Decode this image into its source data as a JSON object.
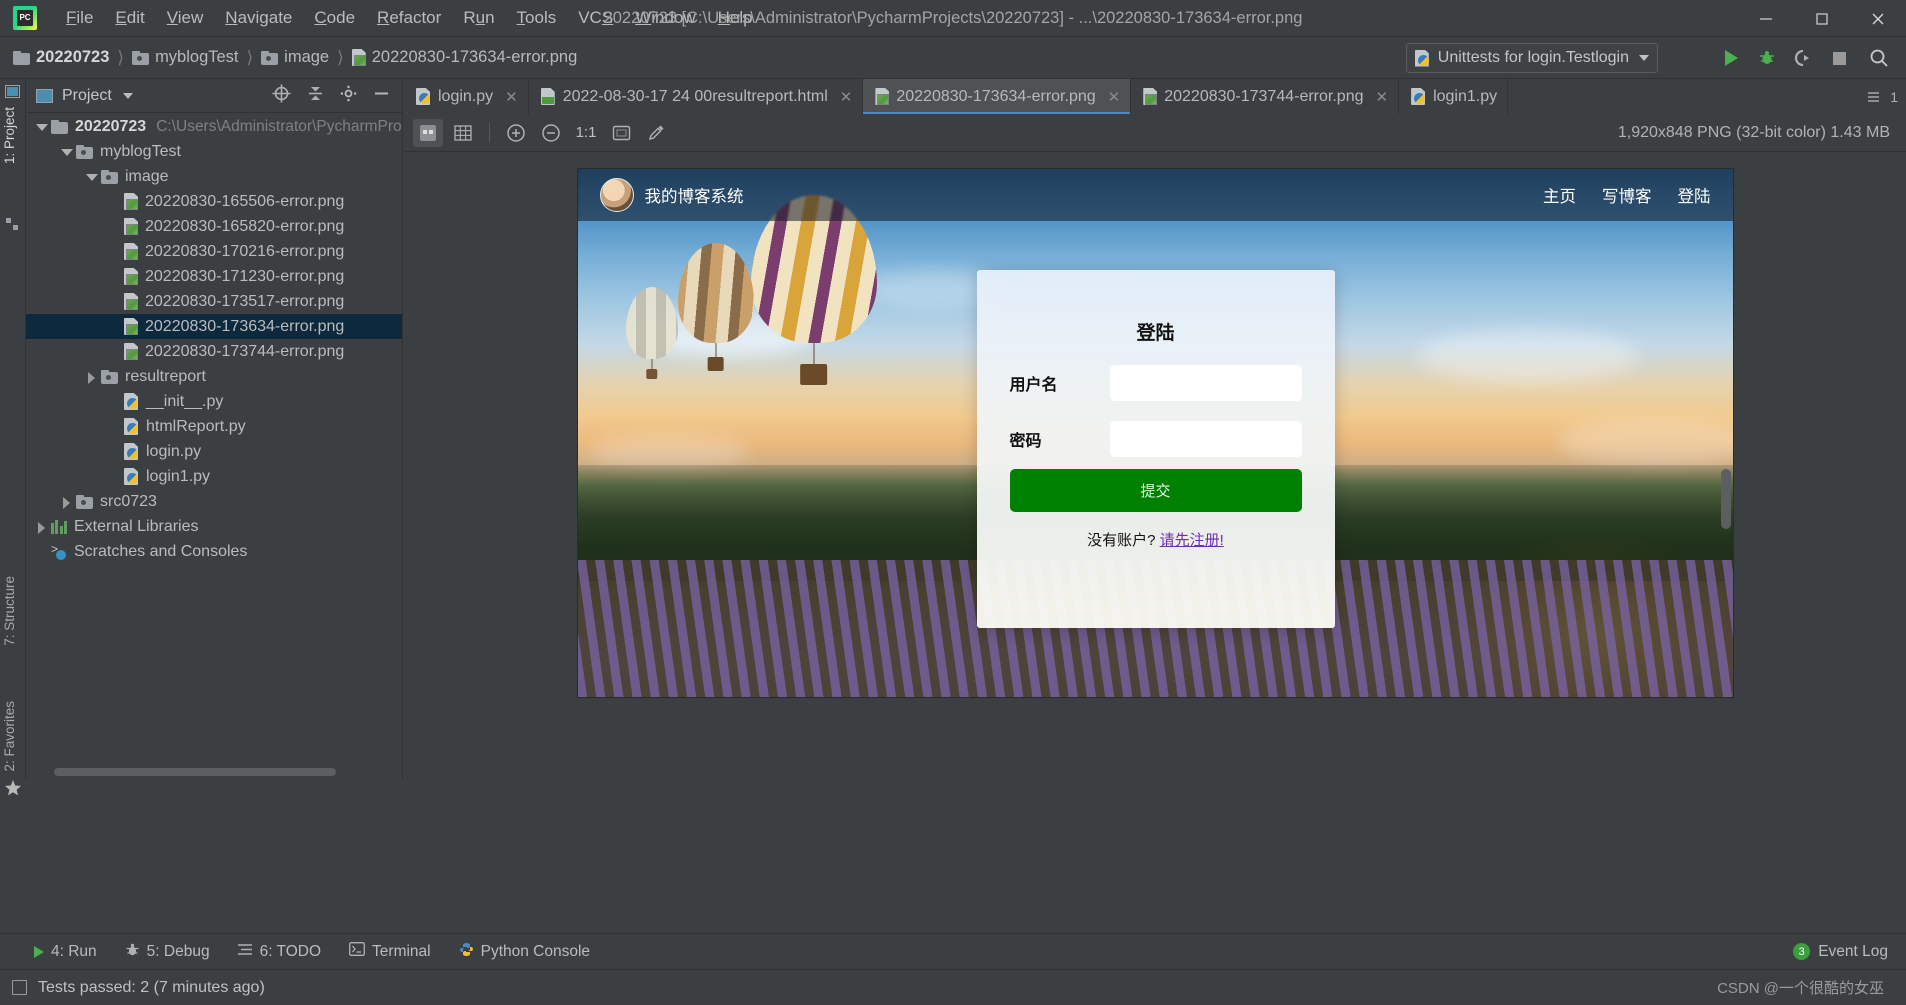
{
  "window": {
    "title": "20220723 [C:\\Users\\Administrator\\PycharmProjects\\20220723] - ...\\20220830-173634-error.png",
    "minimize_label": "—",
    "maximize_label": "☐",
    "close_label": "✕",
    "logo_label": "PC"
  },
  "menubar": [
    {
      "label": "File",
      "mnemonic": "F"
    },
    {
      "label": "Edit",
      "mnemonic": "E"
    },
    {
      "label": "View",
      "mnemonic": "V"
    },
    {
      "label": "Navigate",
      "mnemonic": "N"
    },
    {
      "label": "Code",
      "mnemonic": "C"
    },
    {
      "label": "Refactor",
      "mnemonic": "R"
    },
    {
      "label": "Run",
      "mnemonic": "u"
    },
    {
      "label": "Tools",
      "mnemonic": "T"
    },
    {
      "label": "VCS",
      "mnemonic": "S"
    },
    {
      "label": "Window",
      "mnemonic": "W"
    },
    {
      "label": "Help",
      "mnemonic": "H"
    }
  ],
  "breadcrumb": [
    {
      "label": "20220723",
      "icon": "folder-icon",
      "bold": true
    },
    {
      "label": "myblogTest",
      "icon": "folder-icon",
      "bold": false
    },
    {
      "label": "image",
      "icon": "folder-icon",
      "bold": false
    },
    {
      "label": "20220830-173634-error.png",
      "icon": "image-file-icon",
      "bold": false
    }
  ],
  "run_config": {
    "label": "Unittests for login.Testlogin",
    "icon": "python-test-icon",
    "dropdown_icon": "chevron-down-icon"
  },
  "nav_actions": [
    {
      "name": "run-button",
      "icon": "play-icon"
    },
    {
      "name": "debug-button",
      "icon": "bug-icon"
    },
    {
      "name": "run-with-coverage-button",
      "icon": "coverage-icon"
    },
    {
      "name": "stop-button",
      "icon": "stop-icon"
    },
    {
      "name": "search-everywhere-button",
      "icon": "search-icon"
    }
  ],
  "left_strip": [
    {
      "label": "1: Project",
      "selected": true
    },
    {
      "label": "7: Structure",
      "selected": false
    },
    {
      "label": "2: Favorites",
      "selected": false
    }
  ],
  "project_panel": {
    "title": "Project",
    "caret_icon": "chevron-down-icon",
    "header_actions": [
      {
        "name": "select-opened-file-button",
        "icon": "target-icon"
      },
      {
        "name": "collapse-all-button",
        "icon": "collapse-icon"
      },
      {
        "name": "settings-button",
        "icon": "gear-icon"
      },
      {
        "name": "hide-button",
        "icon": "minus-icon"
      }
    ],
    "tree": [
      {
        "label": "20220723",
        "path": "C:\\Users\\Administrator\\PycharmPro",
        "indent": 0,
        "arrow": "down",
        "icon": "folder-icon",
        "bold": true,
        "selected": false
      },
      {
        "label": "myblogTest",
        "path": "",
        "indent": 1,
        "arrow": "down",
        "icon": "folder-icon",
        "bold": false,
        "selected": false
      },
      {
        "label": "image",
        "path": "",
        "indent": 2,
        "arrow": "down",
        "icon": "folder-icon",
        "bold": false,
        "selected": false
      },
      {
        "label": "20220830-165506-error.png",
        "path": "",
        "indent": 4,
        "arrow": "none",
        "icon": "image-file-icon",
        "bold": false,
        "selected": false
      },
      {
        "label": "20220830-165820-error.png",
        "path": "",
        "indent": 4,
        "arrow": "none",
        "icon": "image-file-icon",
        "bold": false,
        "selected": false
      },
      {
        "label": "20220830-170216-error.png",
        "path": "",
        "indent": 4,
        "arrow": "none",
        "icon": "image-file-icon",
        "bold": false,
        "selected": false
      },
      {
        "label": "20220830-171230-error.png",
        "path": "",
        "indent": 4,
        "arrow": "none",
        "icon": "image-file-icon",
        "bold": false,
        "selected": false
      },
      {
        "label": "20220830-173517-error.png",
        "path": "",
        "indent": 4,
        "arrow": "none",
        "icon": "image-file-icon",
        "bold": false,
        "selected": false
      },
      {
        "label": "20220830-173634-error.png",
        "path": "",
        "indent": 4,
        "arrow": "none",
        "icon": "image-file-icon",
        "bold": false,
        "selected": true
      },
      {
        "label": "20220830-173744-error.png",
        "path": "",
        "indent": 4,
        "arrow": "none",
        "icon": "image-file-icon",
        "bold": false,
        "selected": false
      },
      {
        "label": "resultreport",
        "path": "",
        "indent": 2,
        "arrow": "right",
        "icon": "folder-icon",
        "bold": false,
        "selected": false
      },
      {
        "label": "__init__.py",
        "path": "",
        "indent": 3,
        "arrow": "none",
        "icon": "python-file-icon",
        "bold": false,
        "selected": false
      },
      {
        "label": "htmlReport.py",
        "path": "",
        "indent": 3,
        "arrow": "none",
        "icon": "python-file-icon",
        "bold": false,
        "selected": false
      },
      {
        "label": "login.py",
        "path": "",
        "indent": 3,
        "arrow": "none",
        "icon": "python-file-icon",
        "bold": false,
        "selected": false
      },
      {
        "label": "login1.py",
        "path": "",
        "indent": 3,
        "arrow": "none",
        "icon": "python-file-icon",
        "bold": false,
        "selected": false
      },
      {
        "label": "src0723",
        "path": "",
        "indent": 1,
        "arrow": "right",
        "icon": "folder-icon",
        "bold": false,
        "selected": false
      },
      {
        "label": "External Libraries",
        "path": "",
        "indent": 0,
        "arrow": "right",
        "icon": "library-icon",
        "bold": false,
        "selected": false
      },
      {
        "label": "Scratches and Consoles",
        "path": "",
        "indent": 0,
        "arrow": "none",
        "icon": "scratch-icon",
        "bold": false,
        "selected": false
      }
    ]
  },
  "editor": {
    "tabs": [
      {
        "label": "login.py",
        "icon": "python-file-icon",
        "active": false,
        "closable": true
      },
      {
        "label": "2022-08-30-17 24 00resultreport.html",
        "icon": "html-file-icon",
        "active": false,
        "closable": true
      },
      {
        "label": "20220830-173634-error.png",
        "icon": "image-file-icon",
        "active": true,
        "closable": true
      },
      {
        "label": "20220830-173744-error.png",
        "icon": "image-file-icon",
        "active": false,
        "closable": false
      },
      {
        "label": "login1.py",
        "icon": "python-file-icon",
        "active": false,
        "closable": false
      }
    ],
    "tab_overflow_label": "1",
    "image_toolbar": [
      {
        "name": "toggle-transparency-chessboard-button",
        "icon": "chessboard-icon",
        "active": true
      },
      {
        "name": "toggle-grid-button",
        "icon": "grid-icon",
        "active": false
      },
      {
        "name": "zoom-in-button",
        "icon": "zoom-in-icon",
        "active": false
      },
      {
        "name": "zoom-out-button",
        "icon": "zoom-out-icon",
        "active": false
      },
      {
        "name": "actual-size-button",
        "icon": "one-to-one-icon",
        "label": "1:1",
        "active": false
      },
      {
        "name": "fit-to-window-button",
        "icon": "fit-icon",
        "active": false
      },
      {
        "name": "color-picker-button",
        "icon": "eyedropper-icon",
        "active": false
      }
    ],
    "image_info": "1,920x848 PNG (32-bit color) 1.43 MB"
  },
  "preview": {
    "site": {
      "title": "我的博客系统",
      "avatar": "user-avatar",
      "nav": [
        "主页",
        "写博客",
        "登陆"
      ]
    },
    "login_card": {
      "heading": "登陆",
      "username_label": "用户名",
      "username_value": "",
      "password_label": "密码",
      "password_value": "",
      "submit_label": "提交",
      "note_prefix": "没有账户?",
      "note_link": "请先注册!",
      "submit_color": "#008000",
      "link_color": "#6e2fae"
    }
  },
  "bottom_bar": {
    "items": [
      {
        "label": "4: Run",
        "icon": "play-icon",
        "mnemonic": "4"
      },
      {
        "label": "5: Debug",
        "icon": "bug-icon",
        "mnemonic": "5"
      },
      {
        "label": "6: TODO",
        "icon": "list-icon",
        "mnemonic": "6"
      },
      {
        "label": "Terminal",
        "icon": "terminal-icon",
        "mnemonic": ""
      },
      {
        "label": "Python Console",
        "icon": "python-icon",
        "mnemonic": ""
      }
    ],
    "event_log": {
      "label": "Event Log",
      "badge": "3",
      "icon": "event-log-icon"
    }
  },
  "status_bar": {
    "message": "Tests passed: 2 (7 minutes ago)",
    "icon": "status-square-icon",
    "watermark": "CSDN @一个很酷的女巫"
  }
}
